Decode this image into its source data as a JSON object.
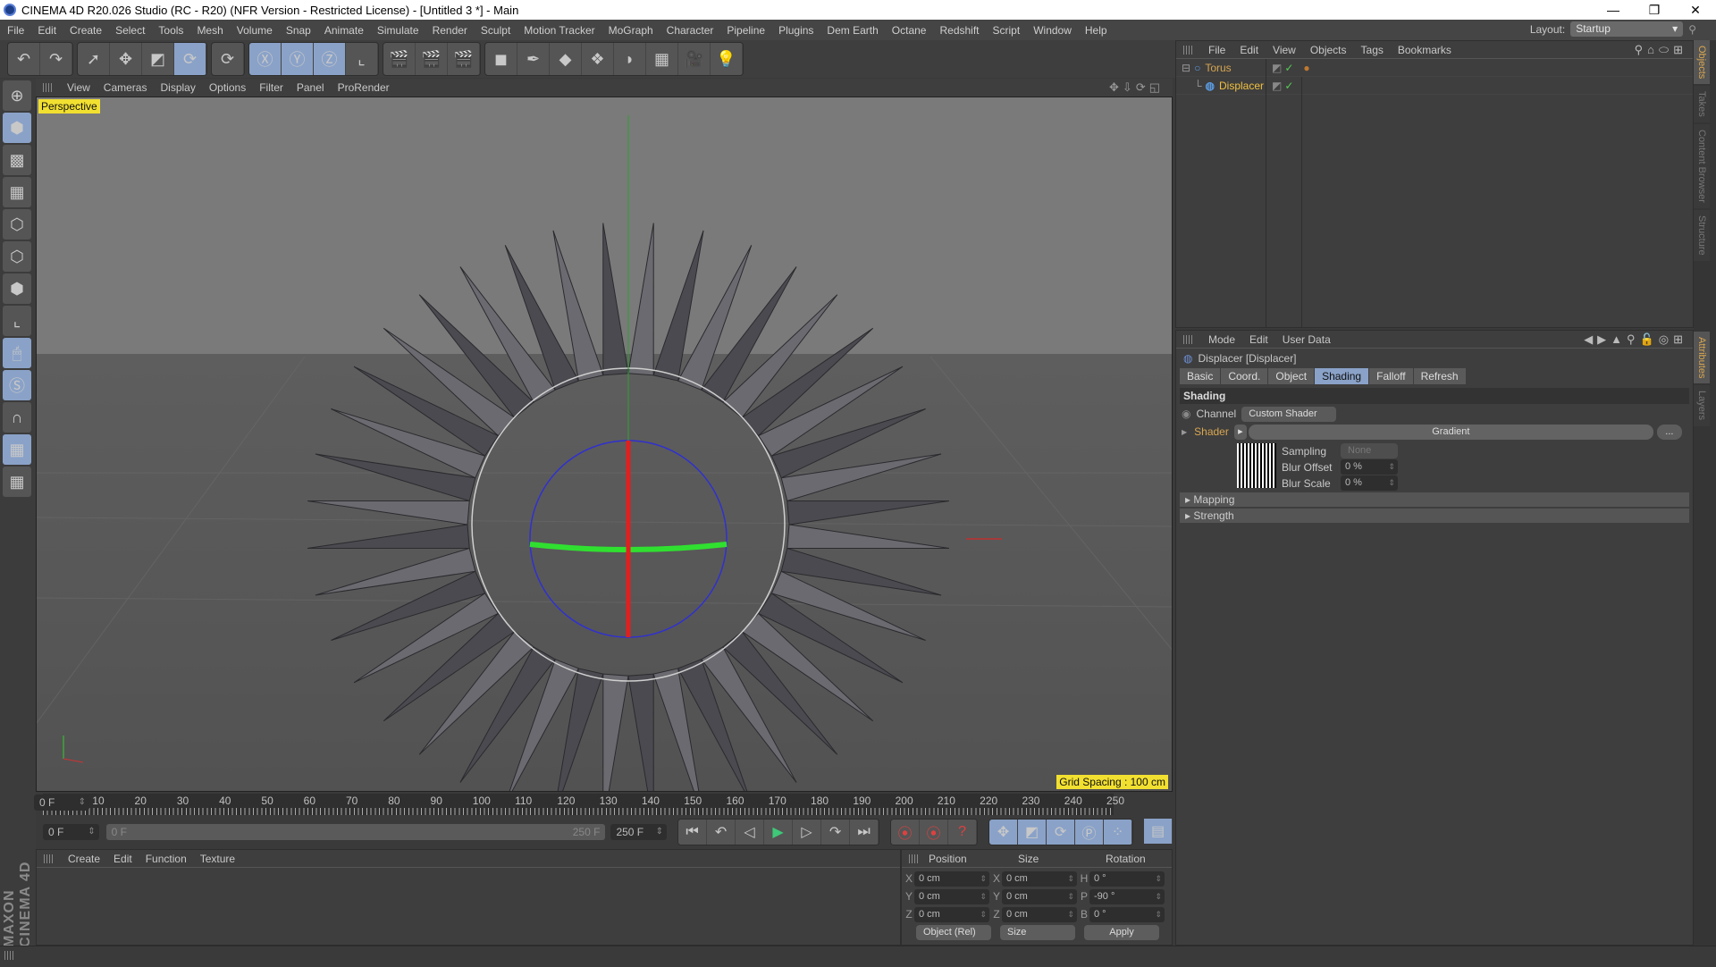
{
  "window": {
    "title": "CINEMA 4D R20.026 Studio (RC - R20) (NFR Version - Restricted License) - [Untitled 3 *] - Main",
    "controls": [
      "—",
      "❐",
      "✕"
    ]
  },
  "menu": [
    "File",
    "Edit",
    "Create",
    "Select",
    "Tools",
    "Mesh",
    "Volume",
    "Snap",
    "Animate",
    "Simulate",
    "Render",
    "Sculpt",
    "Motion Tracker",
    "MoGraph",
    "Character",
    "Pipeline",
    "Plugins",
    "Dem Earth",
    "Octane",
    "Redshift",
    "Script",
    "Window",
    "Help"
  ],
  "layout": {
    "label": "Layout:",
    "value": "Startup"
  },
  "toolbar": {
    "groups": [
      [
        {
          "icon": "undo-icon",
          "glyph": "↶"
        },
        {
          "icon": "redo-icon",
          "glyph": "↷"
        }
      ],
      [
        {
          "icon": "live-selection-icon",
          "glyph": "➚"
        },
        {
          "icon": "move-icon",
          "glyph": "✥"
        },
        {
          "icon": "scale-icon",
          "glyph": "◩"
        },
        {
          "icon": "rotate-icon",
          "glyph": "⟳",
          "active": true
        }
      ],
      [
        {
          "icon": "recent-tools-icon",
          "glyph": "⟳"
        }
      ],
      [
        {
          "icon": "x-axis-lock-icon",
          "glyph": "Ⓧ",
          "active": true
        },
        {
          "icon": "y-axis-lock-icon",
          "glyph": "Ⓨ",
          "active": true
        },
        {
          "icon": "z-axis-lock-icon",
          "glyph": "Ⓩ",
          "active": true
        },
        {
          "icon": "coordinate-system-icon",
          "glyph": "⌞"
        }
      ],
      [
        {
          "icon": "render-view-icon",
          "glyph": "🎬"
        },
        {
          "icon": "render-picture-viewer-icon",
          "glyph": "🎬"
        },
        {
          "icon": "render-settings-icon",
          "glyph": "🎬"
        }
      ],
      [
        {
          "icon": "cube-icon",
          "glyph": "◼"
        },
        {
          "icon": "pen-spline-icon",
          "glyph": "✒"
        },
        {
          "icon": "subdivision-surface-icon",
          "glyph": "◆"
        },
        {
          "icon": "cloner-icon",
          "glyph": "❖"
        },
        {
          "icon": "deformer-icon",
          "glyph": "◗"
        },
        {
          "icon": "floor-icon",
          "glyph": "▦"
        },
        {
          "icon": "camera-icon",
          "glyph": "🎥"
        },
        {
          "icon": "light-icon",
          "glyph": "💡"
        }
      ]
    ]
  },
  "left_tools": [
    {
      "icon": "make-editable-icon",
      "glyph": "⊕"
    },
    {
      "icon": "model-mode-icon",
      "glyph": "⬢",
      "active": true
    },
    {
      "icon": "texture-mode-icon",
      "glyph": "▩"
    },
    {
      "icon": "workplane-mode-icon",
      "glyph": "▦"
    },
    {
      "icon": "points-mode-icon",
      "glyph": "⬡"
    },
    {
      "icon": "edges-mode-icon",
      "glyph": "⬡"
    },
    {
      "icon": "polygons-mode-icon",
      "glyph": "⬢"
    },
    {
      "icon": "axis-mode-icon",
      "glyph": "⌞"
    },
    {
      "icon": "tweak-mode-icon",
      "glyph": "🖱",
      "active": true
    },
    {
      "icon": "solo-icon",
      "glyph": "Ⓢ",
      "active": true
    },
    {
      "icon": "snap-icon",
      "glyph": "∩"
    },
    {
      "icon": "workplane-lock-icon",
      "glyph": "▦",
      "active": true
    },
    {
      "icon": "workplane-align-icon",
      "glyph": "▦"
    }
  ],
  "brand": "MAXON CINEMA 4D",
  "viewport": {
    "menu": [
      "View",
      "Cameras",
      "Display",
      "Options",
      "Filter",
      "Panel",
      "ProRender"
    ],
    "camera_label": "Perspective",
    "grid_spacing": "Grid Spacing : 100 cm",
    "nav_icons": "✥⇩⟳◱"
  },
  "timeline": {
    "ticks": [
      "0",
      "10",
      "20",
      "30",
      "40",
      "50",
      "60",
      "70",
      "80",
      "90",
      "100",
      "110",
      "120",
      "130",
      "140",
      "150",
      "160",
      "170",
      "180",
      "190",
      "200",
      "210",
      "220",
      "230",
      "240",
      "250"
    ],
    "current_frame": "0 F",
    "range_start": "0 F",
    "slider_start": "0 F",
    "slider_end": "250 F",
    "range_end": "250 F"
  },
  "transport": {
    "playback": [
      "⏮",
      "↶",
      "◁",
      "▶",
      "▷",
      "↷",
      "⏭"
    ],
    "record": [
      "⦿",
      "⦿",
      "?"
    ],
    "keys": [
      "✥",
      "◩",
      "⟳",
      "Ⓟ",
      "⁘"
    ],
    "extra": "▤"
  },
  "material_manager": {
    "menu": [
      "Create",
      "Edit",
      "Function",
      "Texture"
    ]
  },
  "coordinates": {
    "headers": [
      "Position",
      "Size",
      "Rotation"
    ],
    "rows": [
      {
        "pos_axis": "X",
        "pos": "0 cm",
        "size_axis": "X",
        "size": "0 cm",
        "rot_axis": "H",
        "rot": "0 °"
      },
      {
        "pos_axis": "Y",
        "pos": "0 cm",
        "size_axis": "Y",
        "size": "0 cm",
        "rot_axis": "P",
        "rot": "-90 °"
      },
      {
        "pos_axis": "Z",
        "pos": "0 cm",
        "size_axis": "Z",
        "size": "0 cm",
        "rot_axis": "B",
        "rot": "0 °"
      }
    ],
    "mode": "Object (Rel)",
    "size_mode": "Size",
    "apply": "Apply"
  },
  "object_manager": {
    "menu": [
      "File",
      "Edit",
      "View",
      "Objects",
      "Tags",
      "Bookmarks"
    ],
    "objects": [
      {
        "name": "Torus",
        "icon": "torus-icon",
        "level": 0
      },
      {
        "name": "Displacer",
        "icon": "displacer-icon",
        "level": 1
      }
    ]
  },
  "attributes": {
    "menu": [
      "Mode",
      "Edit",
      "User Data"
    ],
    "title": "Displacer [Displacer]",
    "tabs": [
      "Basic",
      "Coord.",
      "Object",
      "Shading",
      "Falloff",
      "Refresh"
    ],
    "active_tab": "Shading",
    "section": "Shading",
    "channel_label": "Channel",
    "channel_value": "Custom Shader",
    "shader_label": "Shader",
    "shader_value": "Gradient",
    "shader_more": "...",
    "sampling_label": "Sampling",
    "sampling_value": "None",
    "blur_offset_label": "Blur Offset",
    "blur_offset_value": "0 %",
    "blur_scale_label": "Blur Scale",
    "blur_scale_value": "0 %",
    "folds": [
      "Mapping",
      "Strength"
    ]
  },
  "side_tabs": {
    "top": [
      {
        "label": "Objects",
        "active": true
      },
      {
        "label": "Takes"
      },
      {
        "label": "Content Browser"
      },
      {
        "label": "Structure"
      }
    ],
    "bottom": [
      {
        "label": "Attributes",
        "active": true
      },
      {
        "label": "Layers"
      }
    ]
  }
}
